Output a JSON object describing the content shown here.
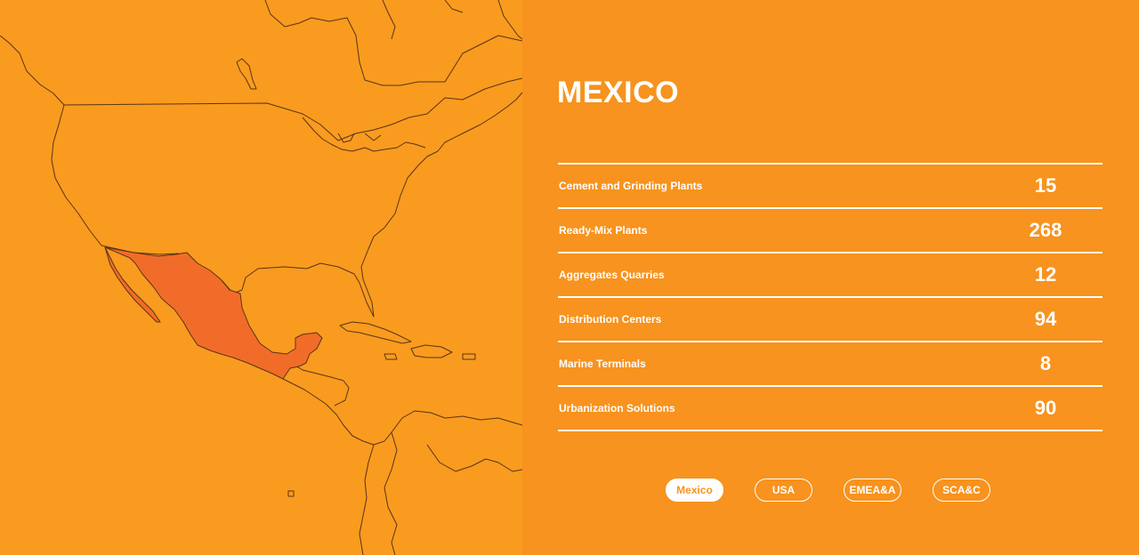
{
  "colors": {
    "map_background": "#f99b1f",
    "panel_background": "#f7931e",
    "highlight_country": "#f26c29",
    "outline": "#5a3417",
    "text": "#ffffff"
  },
  "map": {
    "highlighted_country": "Mexico"
  },
  "region": {
    "title": "MEXICO"
  },
  "stats": [
    {
      "label": "Cement and Grinding Plants",
      "value": "15"
    },
    {
      "label": "Ready-Mix Plants",
      "value": "268"
    },
    {
      "label": "Aggregates Quarries",
      "value": "12"
    },
    {
      "label": "Distribution Centers",
      "value": "94"
    },
    {
      "label": "Marine Terminals",
      "value": "8"
    },
    {
      "label": "Urbanization Solutions",
      "value": "90"
    }
  ],
  "tabs": [
    {
      "label": "Mexico",
      "active": true
    },
    {
      "label": "USA",
      "active": false
    },
    {
      "label": "EMEA&A",
      "active": false
    },
    {
      "label": "SCA&C",
      "active": false
    }
  ]
}
